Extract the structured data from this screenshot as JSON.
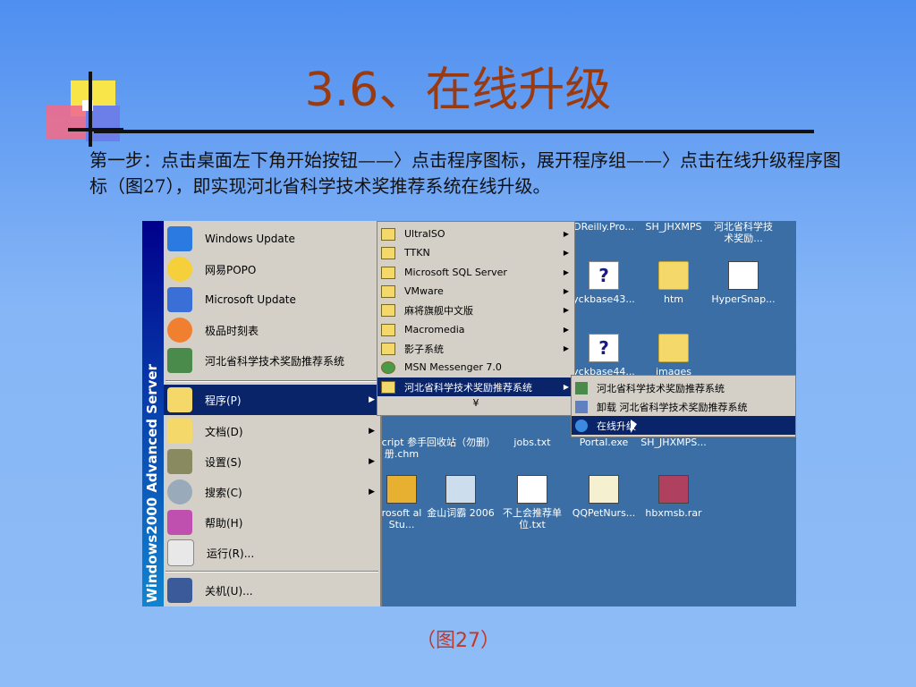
{
  "slide": {
    "title": "3.6、在线升级",
    "body": "第一步：点击桌面左下角开始按钮——〉点击程序图标，展开程序组——〉点击在线升级程序图标（图27），即实现河北省科学技术奖推荐系统在线升级。",
    "caption": "（图27）"
  },
  "screenshot": {
    "banner": "Windows2000 Advanced Server",
    "start_menu": [
      {
        "label": "Windows Update",
        "icon": "windows-update-icon"
      },
      {
        "label": "网易POPO",
        "icon": "popo-icon"
      },
      {
        "label": "Microsoft Update",
        "icon": "microsoft-update-icon"
      },
      {
        "label": "极品时刻表",
        "icon": "timetable-icon"
      },
      {
        "label": "河北省科学技术奖励推荐系统",
        "icon": "app-icon"
      },
      {
        "label": "程序(P)",
        "icon": "programs-icon",
        "arrow": "▶"
      },
      {
        "label": "文档(D)",
        "icon": "documents-icon",
        "arrow": "▶"
      },
      {
        "label": "设置(S)",
        "icon": "settings-icon",
        "arrow": "▶"
      },
      {
        "label": "搜索(C)",
        "icon": "search-icon",
        "arrow": "▶"
      },
      {
        "label": "帮助(H)",
        "icon": "help-icon"
      },
      {
        "label": "运行(R)...",
        "icon": "run-icon"
      },
      {
        "label": "关机(U)...",
        "icon": "shutdown-icon"
      }
    ],
    "programs_menu": [
      {
        "label": "UltraISO",
        "arrow": "▶"
      },
      {
        "label": "TTKN",
        "arrow": "▶"
      },
      {
        "label": "Microsoft SQL Server",
        "arrow": "▶"
      },
      {
        "label": "VMware",
        "arrow": "▶"
      },
      {
        "label": "麻将旗舰中文版",
        "arrow": "▶"
      },
      {
        "label": "Macromedia",
        "arrow": "▶"
      },
      {
        "label": "影子系统",
        "arrow": "▶"
      },
      {
        "label": "MSN Messenger 7.0",
        "arrow": ""
      },
      {
        "label": "河北省科学技术奖励推荐系统",
        "arrow": "▶"
      }
    ],
    "programs_more": "¥",
    "app_menu": [
      {
        "label": "河北省科学技术奖励推荐系统"
      },
      {
        "label": "卸载 河北省科学技术奖励推荐系统"
      },
      {
        "label": "在线升级"
      }
    ],
    "desktop_icons": [
      {
        "label": "DReilly.Pro..."
      },
      {
        "label": "SH_JHXMPS"
      },
      {
        "label": "河北省科学技术奖励..."
      },
      {
        "label": "yckbase43..."
      },
      {
        "label": "htm"
      },
      {
        "label": "HyperSnap..."
      },
      {
        "label": "yckbase44..."
      },
      {
        "label": "images"
      },
      {
        "label": "script 参手册.chm"
      },
      {
        "label": "回收站（勿删）"
      },
      {
        "label": "jobs.txt"
      },
      {
        "label": "Portal.exe"
      },
      {
        "label": "SH_JHXMPS..."
      },
      {
        "label": "rosoft al Stu..."
      },
      {
        "label": "金山词霸 2006"
      },
      {
        "label": "不上会推荐单位.txt"
      },
      {
        "label": "QQPetNurs..."
      },
      {
        "label": "hbxmsb.rar"
      }
    ]
  }
}
